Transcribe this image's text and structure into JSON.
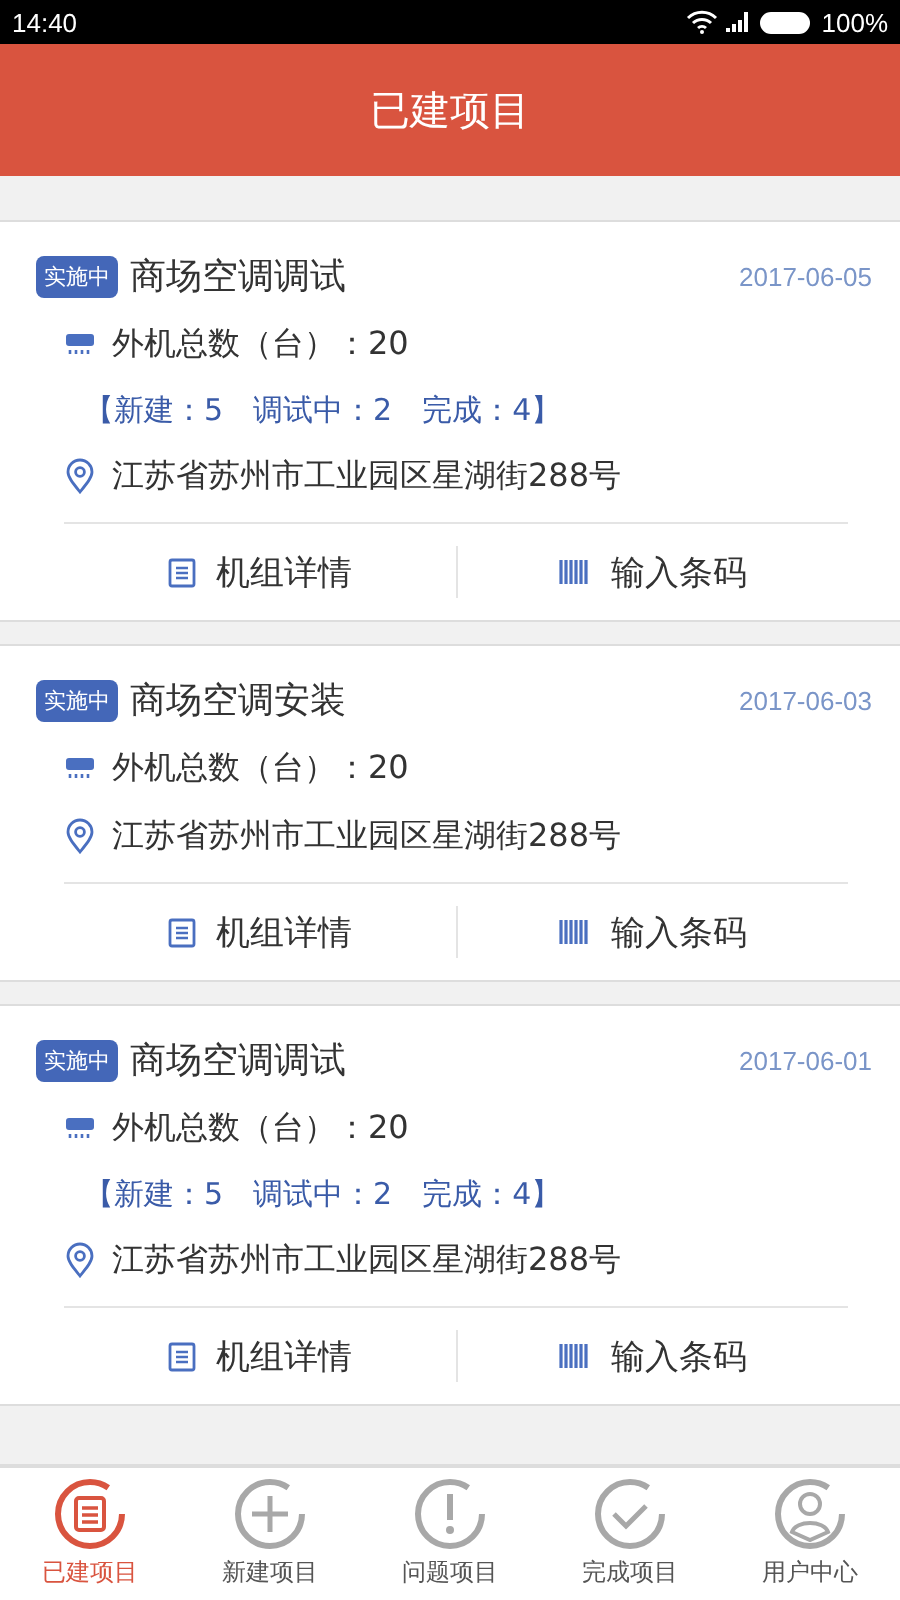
{
  "status_bar": {
    "time": "14:40",
    "battery": "100%"
  },
  "header": {
    "title": "已建项目"
  },
  "projects": [
    {
      "status": "实施中",
      "name": "商场空调调试",
      "date": "2017-06-05",
      "units": "外机总数（台）：20",
      "counts": "【新建：5　调试中：2　完成：4】",
      "address": "江苏省苏州市工业园区星湖街288号",
      "actions": [
        "机组详情",
        "输入条码"
      ]
    },
    {
      "status": "实施中",
      "name": "商场空调安装",
      "date": "2017-06-03",
      "units": "外机总数（台）：20",
      "address": "江苏省苏州市工业园区星湖街288号",
      "actions": [
        "机组详情",
        "输入条码"
      ]
    },
    {
      "status": "实施中",
      "name": "商场空调调试",
      "date": "2017-06-01",
      "units": "外机总数（台）：20",
      "counts": "【新建：5　调试中：2　完成：4】",
      "address": "江苏省苏州市工业园区星湖街288号",
      "actions": [
        "机组详情",
        "输入条码"
      ]
    }
  ],
  "tabs": [
    {
      "label": "已建项目",
      "kind": "list",
      "selected": true
    },
    {
      "label": "新建项目",
      "kind": "plus",
      "selected": false
    },
    {
      "label": "问题项目",
      "kind": "alert",
      "selected": false
    },
    {
      "label": "完成项目",
      "kind": "check",
      "selected": false
    },
    {
      "label": "用户中心",
      "kind": "user",
      "selected": false
    }
  ]
}
